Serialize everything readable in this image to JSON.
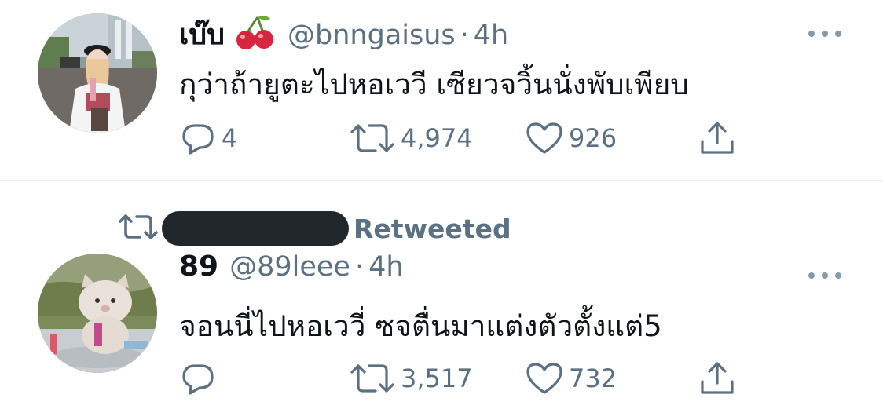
{
  "tweets": [
    {
      "display_name": "เบ๊บ",
      "emoji": "cherry",
      "handle": "@bnngaisus",
      "separator": "·",
      "time": "4h",
      "text": "กุว่าถ้ายูตะไปหอเววี เซียวจวิ้นนั่งพับเพียบ",
      "replies": "4",
      "retweets": "4,974",
      "likes": "926"
    },
    {
      "retweeted_label": "Retweeted",
      "display_name": "89",
      "handle": "@89leee",
      "separator": "·",
      "time": "4h",
      "text": "จอนนี่ไปหอเววี่ ซจตื่นมาแต่งตัวตั้งแต่5",
      "replies": "",
      "retweets": "3,517",
      "likes": "732"
    }
  ],
  "colors": {
    "secondary_text": "#5b7083",
    "primary_text": "#0f1419",
    "divider": "#e6ecf0",
    "redaction": "#22272c"
  },
  "icons": [
    "more-icon",
    "reply-icon",
    "retweet-icon",
    "like-icon",
    "share-icon",
    "cherry-emoji"
  ]
}
